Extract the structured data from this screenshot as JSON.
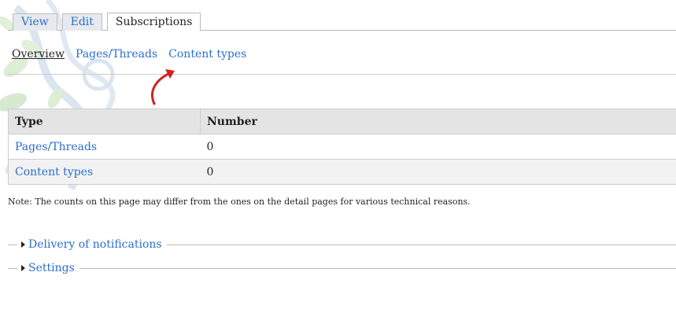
{
  "tabs_primary": [
    {
      "label": "View"
    },
    {
      "label": "Edit"
    },
    {
      "label": "Subscriptions",
      "active": true
    }
  ],
  "tabs_secondary": [
    {
      "label": "Overview",
      "active": true
    },
    {
      "label": "Pages/Threads"
    },
    {
      "label": "Content types"
    }
  ],
  "table": {
    "headers": [
      "Type",
      "Number"
    ],
    "rows": [
      {
        "type": "Pages/Threads",
        "number": "0"
      },
      {
        "type": "Content types",
        "number": "0"
      }
    ]
  },
  "note": "Note: The counts on this page may differ from the ones on the detail pages for various technical reasons.",
  "fieldsets": [
    {
      "legend": "Delivery of notifications",
      "collapsed": true
    },
    {
      "legend": "Settings",
      "collapsed": true
    }
  ],
  "colors": {
    "link": "#2b6dc9",
    "arrow": "#d42020",
    "header_bg": "#e4e4e4"
  },
  "icons": {
    "annotation": "red-arrow-icon",
    "collapse": "triangle-right-icon"
  }
}
